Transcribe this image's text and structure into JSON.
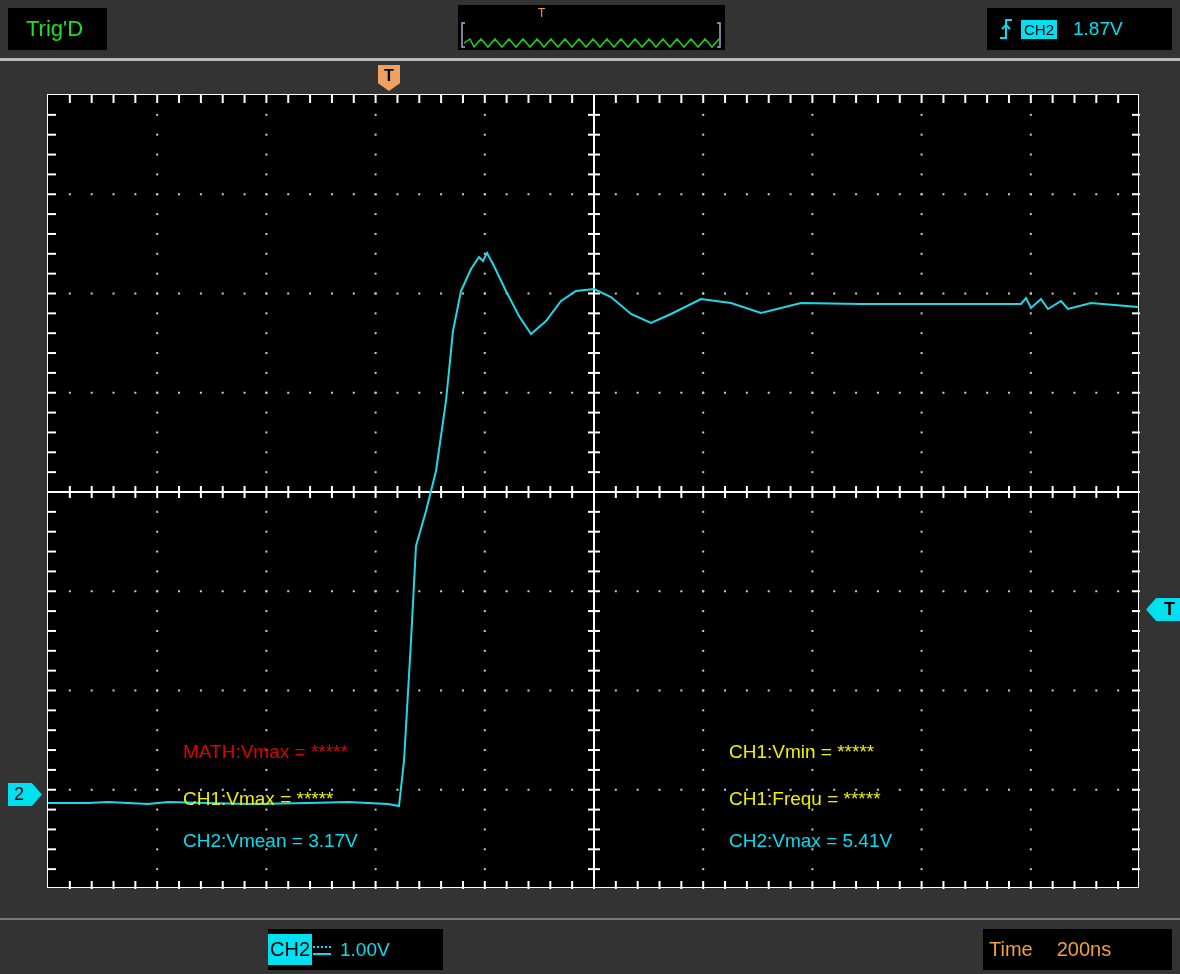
{
  "top_bar": {
    "trigger_status": "Trig'D",
    "overview_marker": "T",
    "trigger_source": "CH2",
    "trigger_level": "1.87V"
  },
  "screen": {
    "trigger_position_marker": "T",
    "channel_marker": "2",
    "trigger_level_marker": "T"
  },
  "measurements": [
    {
      "text": "MATH:Vmax = *****",
      "color": "#e00000"
    },
    {
      "text": "CH1:Vmin = *****",
      "color": "#f0f000"
    },
    {
      "text": "CH1:Vmax = *****",
      "color": "#f0f000"
    },
    {
      "text": "CH1:Frequ = *****",
      "color": "#f0f000"
    },
    {
      "text": "CH2:Vmean = 3.17V",
      "color": "#00e0f0"
    },
    {
      "text": "CH2:Vmax = 5.41V",
      "color": "#00e0f0"
    }
  ],
  "bottom_bar": {
    "channel": "CH2",
    "volts_per_div": "1.00V",
    "time_label": "Time",
    "time_per_div": "200ns"
  }
}
